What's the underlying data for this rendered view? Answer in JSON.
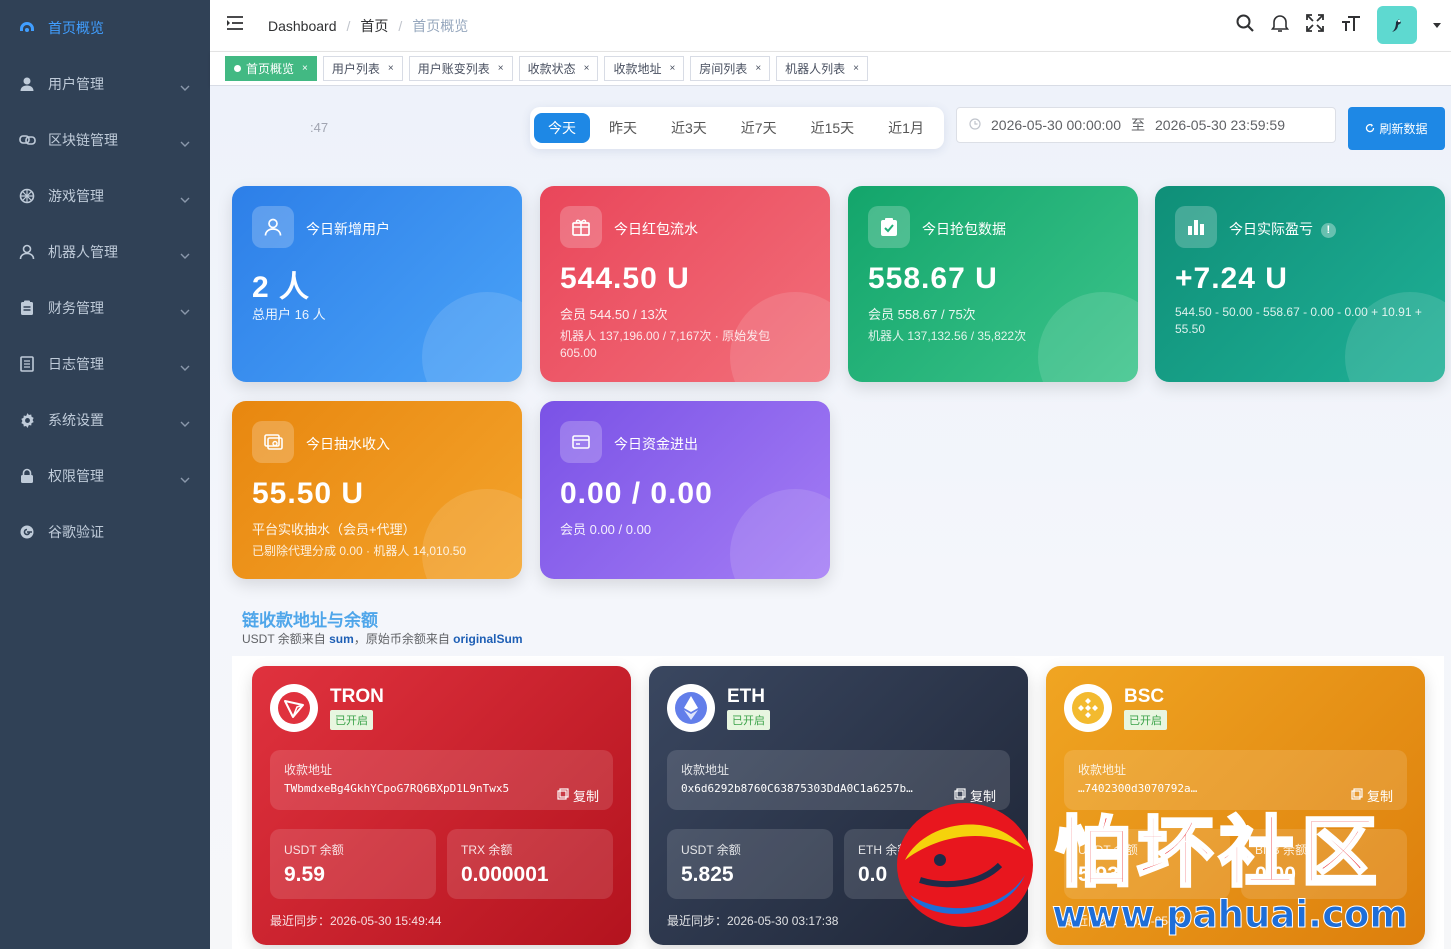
{
  "sidebar": {
    "items": [
      {
        "label": "首页概览",
        "icon": "dashboard-icon",
        "active": true,
        "has_children": false
      },
      {
        "label": "用户管理",
        "icon": "user-icon",
        "has_children": true
      },
      {
        "label": "区块链管理",
        "icon": "chain-icon",
        "has_children": true
      },
      {
        "label": "游戏管理",
        "icon": "game-icon",
        "has_children": true
      },
      {
        "label": "机器人管理",
        "icon": "robot-icon",
        "has_children": true
      },
      {
        "label": "财务管理",
        "icon": "finance-icon",
        "has_children": true
      },
      {
        "label": "日志管理",
        "icon": "log-icon",
        "has_children": true
      },
      {
        "label": "系统设置",
        "icon": "gear-icon",
        "has_children": true
      },
      {
        "label": "权限管理",
        "icon": "lock-icon",
        "has_children": true
      },
      {
        "label": "谷歌验证",
        "icon": "google-icon",
        "has_children": false
      }
    ]
  },
  "header": {
    "breadcrumb": [
      "Dashboard",
      "首页",
      "首页概览"
    ],
    "separator": "/",
    "tools": [
      "search-icon",
      "bell-icon",
      "fullscreen-icon",
      "font-size-icon"
    ]
  },
  "tags": [
    {
      "label": "首页概览",
      "active": true
    },
    {
      "label": "用户列表"
    },
    {
      "label": "用户账变列表"
    },
    {
      "label": "收款状态"
    },
    {
      "label": "收款地址"
    },
    {
      "label": "房间列表"
    },
    {
      "label": "机器人列表"
    }
  ],
  "toolbar": {
    "time_fragment": ":47",
    "ranges": [
      "今天",
      "昨天",
      "近3天",
      "近7天",
      "近15天",
      "近1月"
    ],
    "active_range": 0,
    "date_start": "2026-05-30 00:00:00",
    "date_sep": "至",
    "date_end": "2026-05-30 23:59:59",
    "refresh_label": "刷新数据"
  },
  "stats": {
    "new_users": {
      "title": "今日新增用户",
      "value": "2 人",
      "sub": "总用户 16 人"
    },
    "red_flow": {
      "title": "今日红包流水",
      "value": "544.50 U",
      "sub": "会员 544.50 / 13次",
      "sub2": "机器人 137,196.00 / 7,167次 · 原始发包 605.00"
    },
    "grab": {
      "title": "今日抢包数据",
      "value": "558.67 U",
      "sub": "会员 558.67 / 75次",
      "sub2": "机器人 137,132.56 / 35,822次"
    },
    "profit": {
      "title": "今日实际盈亏",
      "value": "+7.24 U",
      "sub": "544.50 - 50.00 - 558.67 - 0.00 - 0.00 + 10.91 + 55.50"
    },
    "commission": {
      "title": "今日抽水收入",
      "value": "55.50 U",
      "sub": "平台实收抽水（会员+代理）",
      "sub2": "已剔除代理分成 0.00 · 机器人 14,010.50"
    },
    "funds": {
      "title": "今日资金进出",
      "value": "0.00 / 0.00",
      "sub": "会员 0.00 / 0.00"
    }
  },
  "section": {
    "title": "链收款地址与余额",
    "sub_prefix": "USDT 余额来自 ",
    "sub_key1": "sum",
    "sub_mid": "，原始币余额来自 ",
    "sub_key2": "originalSum"
  },
  "chains": [
    {
      "name": "TRON",
      "status": "已开启",
      "addr_label": "收款地址",
      "address": "TWbmdxeBg4GkhYCpoG7RQ6BXpD1L9nTwx5",
      "copy_label": "复制",
      "usdt_label": "USDT 余额",
      "usdt": "9.59",
      "native_label": "TRX 余额",
      "native": "0.000001",
      "sync": "最近同步：2026-05-30 15:49:44"
    },
    {
      "name": "ETH",
      "status": "已开启",
      "addr_label": "收款地址",
      "address": "0x6d6292b8760C63875303DdA0C1a6257b…",
      "copy_label": "复制",
      "usdt_label": "USDT 余额",
      "usdt": "5.825",
      "native_label": "ETH 余额",
      "native": "0.0",
      "sync": "最近同步：2026-05-30 03:17:38"
    },
    {
      "name": "BSC",
      "status": "已开启",
      "addr_label": "收款地址",
      "address": "…7402300d3070792a…",
      "copy_label": "复制",
      "usdt_label": "USDT 余额",
      "usdt": "5.93",
      "native_label": "BNB 余额",
      "native": "0.00",
      "sync": "最近同步：2026-05-30"
    }
  ],
  "watermark": {
    "text": "怕坏社区",
    "url": "www.pahuai.com"
  },
  "colors": {
    "sidebar_bg": "#304156",
    "accent": "#1e88e5",
    "active_tag": "#42b983"
  }
}
